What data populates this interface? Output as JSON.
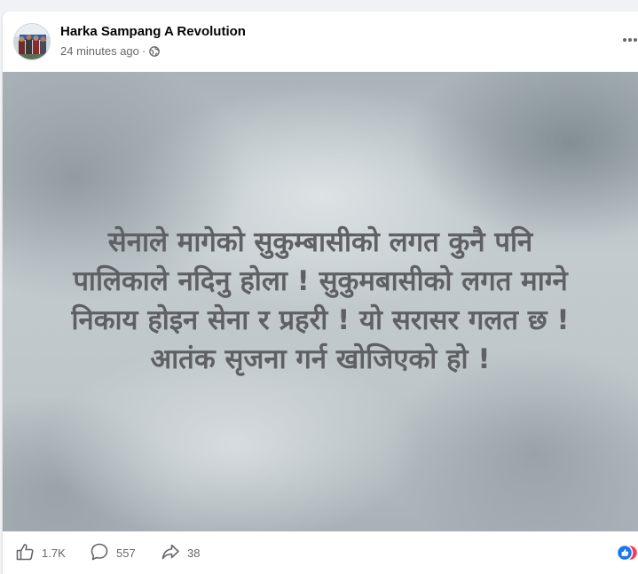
{
  "post": {
    "author": "Harka Sampang A Revolution",
    "timestamp": "24 minutes ago",
    "separator": "·",
    "privacy_icon": "globe-icon",
    "more_icon": "more-options-icon"
  },
  "media": {
    "lines": [
      "सेनाले मागेको सुकुम्बासीको लगत कुनै पनि",
      "पालिकाले नदिनु होला ! सुकुमबासीको लगत माग्ने",
      "निकाय होइन सेना र प्रहरी ! यो सरासर गलत छ !",
      "आतंक सृजना गर्न खोजिएको हो !"
    ]
  },
  "actions": {
    "like_count": "1.7K",
    "comment_count": "557",
    "share_count": "38"
  },
  "colors": {
    "author": "#050505",
    "meta": "#65676b",
    "media_text": "#5f6063",
    "accent": "#1877f2"
  }
}
